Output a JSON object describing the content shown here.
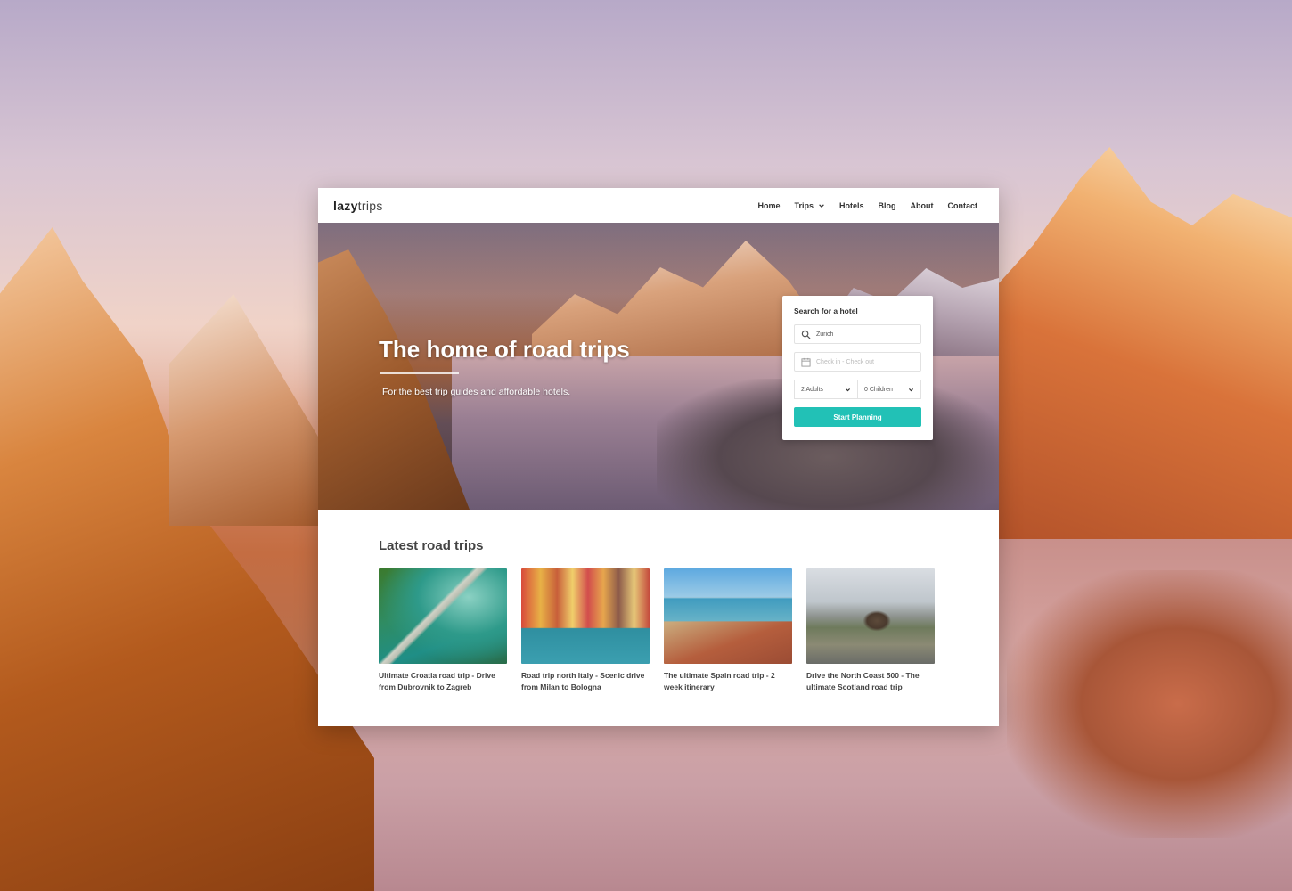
{
  "brand": {
    "logo_bold": "lazy",
    "logo_light": "trips"
  },
  "nav": {
    "home": "Home",
    "trips": "Trips",
    "hotels": "Hotels",
    "blog": "Blog",
    "about": "About",
    "contact": "Contact"
  },
  "hero": {
    "title": "The home of road trips",
    "subtitle": "For the best trip guides and affordable hotels."
  },
  "search": {
    "title": "Search for a hotel",
    "location_value": "Zurich",
    "dates_placeholder": "Check in - Check out",
    "adults": "2 Adults",
    "children": "0 Children",
    "submit_label": "Start Planning",
    "accent_color": "#22c1b6"
  },
  "latest": {
    "heading": "Latest road trips",
    "cards": [
      {
        "title": "Ultimate Croatia road trip - Drive from Dubrovnik to Zagreb"
      },
      {
        "title": "Road trip north Italy - Scenic drive from Milan to Bologna"
      },
      {
        "title": "The ultimate Spain road trip - 2 week itinerary"
      },
      {
        "title": "Drive the North Coast 500 - The ultimate Scotland road trip"
      }
    ]
  }
}
